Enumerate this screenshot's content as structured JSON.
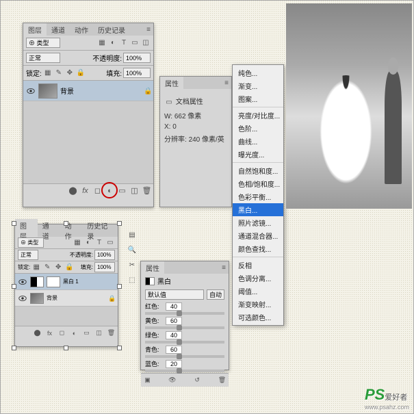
{
  "layers_panel": {
    "tabs": [
      "图层",
      "通道",
      "动作",
      "历史记录"
    ],
    "kind_label": "⊕ 类型",
    "blend_mode": "正常",
    "opacity_label": "不透明度:",
    "opacity_value": "100%",
    "lock_label": "锁定:",
    "fill_label": "填充:",
    "fill_value": "100%",
    "layer_bg": "背景"
  },
  "props_panel": {
    "tab": "属性",
    "doc_props": "文档属性",
    "w_label": "W:",
    "w_value": "662 像素",
    "x_label": "X:",
    "x_value": "0",
    "res_label": "分辨率:",
    "res_value": "240 像素/英"
  },
  "adjust_menu": {
    "items": [
      "纯色...",
      "渐变...",
      "图案...",
      "-",
      "亮度/对比度...",
      "色阶...",
      "曲线...",
      "曝光度...",
      "-",
      "自然饱和度...",
      "色相/饱和度...",
      "色彩平衡...",
      "黑白...",
      "照片滤镜...",
      "通道混合器...",
      "颜色查找...",
      "-",
      "反相",
      "色调分离...",
      "阈值...",
      "渐变映射...",
      "可选颜色..."
    ],
    "highlighted": "黑白..."
  },
  "layers_panel_2": {
    "layer_bw": "黑白 1",
    "layer_bg": "背景"
  },
  "bw_panel": {
    "title": "黑白",
    "preset": "默认值",
    "auto": "自动",
    "sliders": [
      {
        "label": "红色:",
        "value": "40"
      },
      {
        "label": "黄色:",
        "value": "60"
      },
      {
        "label": "绿色:",
        "value": "40"
      },
      {
        "label": "青色:",
        "value": "60"
      },
      {
        "label": "蓝色:",
        "value": "20"
      }
    ]
  },
  "watermark": {
    "main": "PS",
    "suffix": "爱好者",
    "url": "www.psahz.com"
  }
}
